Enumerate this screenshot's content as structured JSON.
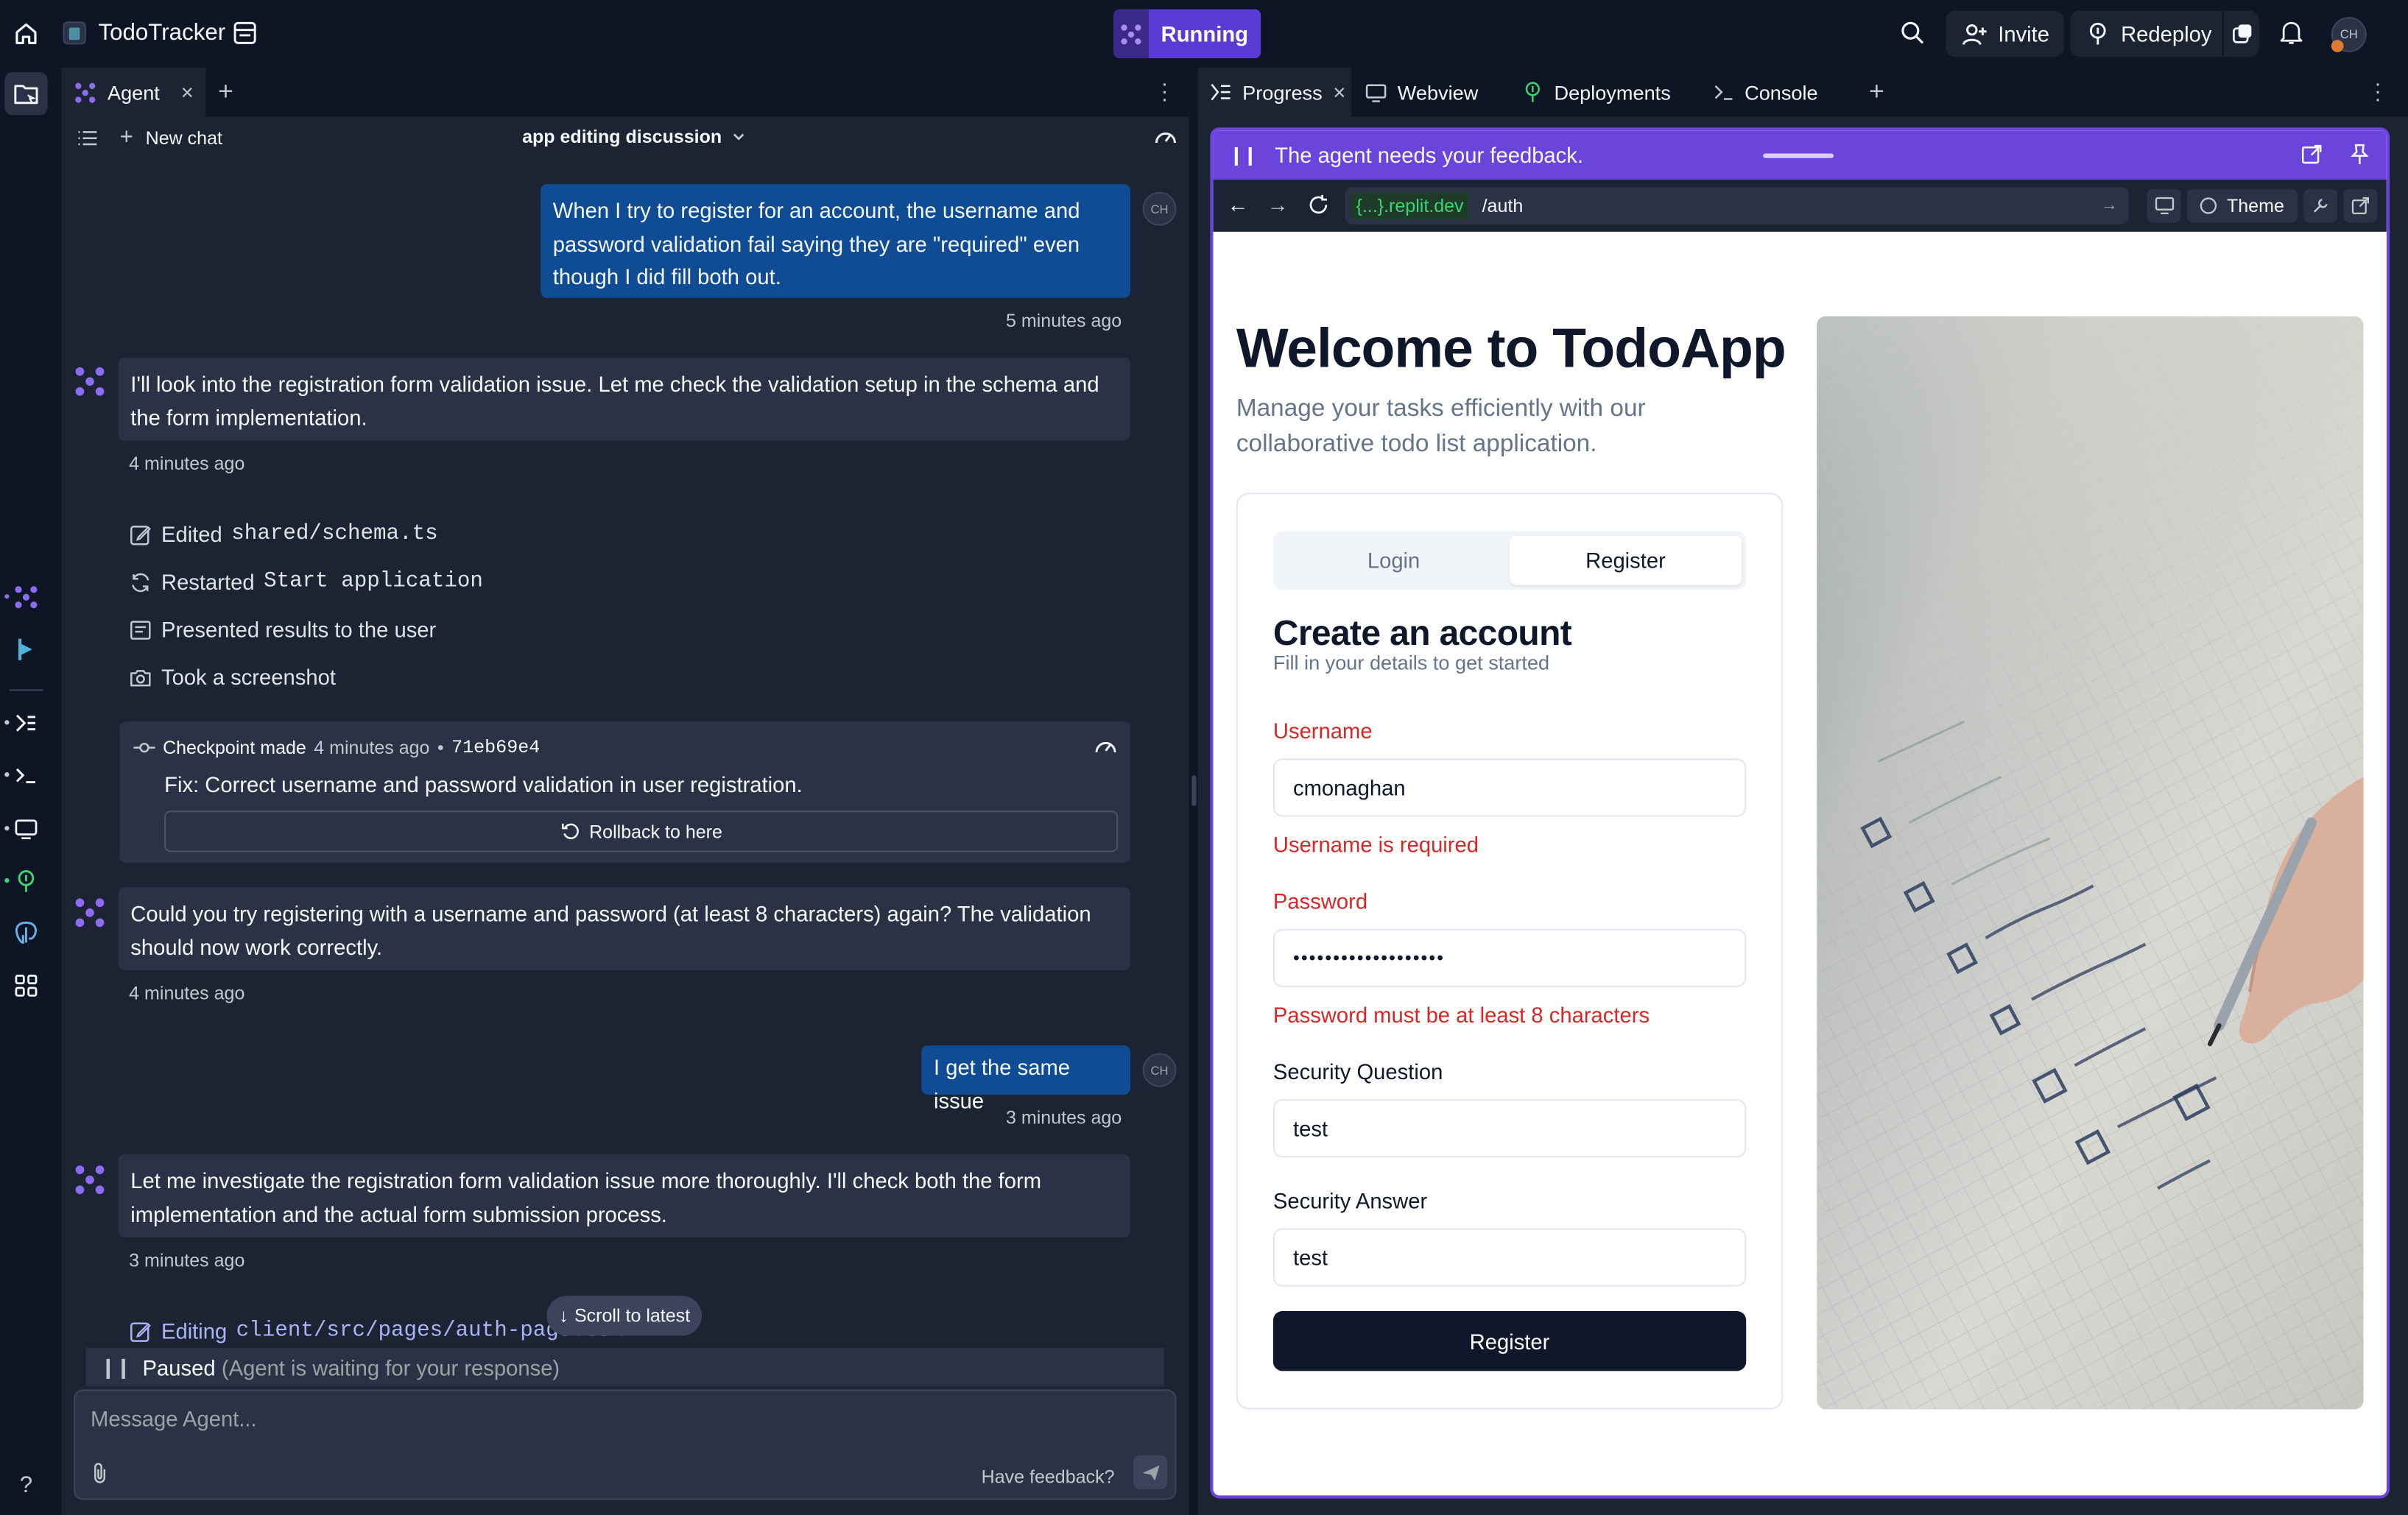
{
  "topbar": {
    "app_name": "TodoTracker",
    "run_label": "Running",
    "invite_label": "Invite",
    "redeploy_label": "Redeploy",
    "avatar_initials": "CH"
  },
  "agent_panel": {
    "tab_label": "Agent",
    "new_chat_label": "New chat",
    "chat_title": "app editing discussion",
    "scroll_latest_label": "Scroll to latest",
    "paused_label": "Paused",
    "paused_detail": "(Agent is waiting for your response)",
    "input_placeholder": "Message Agent...",
    "feedback_label": "Have feedback?",
    "messages": [
      {
        "role": "user",
        "text": "When I try to register for an account, the username and password validation fail saying they are \"required\" even though I did fill both out.",
        "time": "5 minutes ago",
        "initials": "CH"
      },
      {
        "role": "agent",
        "text": "I'll look into the registration form validation issue. Let me check the validation setup in the schema and the form implementation.",
        "time": "4 minutes ago"
      },
      {
        "role": "agent",
        "text": "Could you try registering with a username and password (at least 8 characters) again? The validation should now work correctly.",
        "time": "4 minutes ago"
      },
      {
        "role": "user",
        "text": "I get the same issue",
        "time": "3 minutes ago",
        "initials": "CH"
      },
      {
        "role": "agent",
        "text": "Let me investigate the registration form validation issue more thoroughly. I'll check both the form implementation and the actual form submission process.",
        "time": "3 minutes ago"
      }
    ],
    "actions": [
      {
        "icon": "edit-file-icon",
        "verb": "Edited",
        "target": "shared/schema.ts"
      },
      {
        "icon": "restart-icon",
        "verb": "Restarted",
        "target": "Start application"
      },
      {
        "icon": "present-icon",
        "verb": "Presented results to the user",
        "target": ""
      },
      {
        "icon": "camera-icon",
        "verb": "Took a screenshot",
        "target": ""
      }
    ],
    "checkpoint": {
      "label": "Checkpoint made",
      "time": "4 minutes ago",
      "separator": "•",
      "hash": "71eb69e4",
      "message": "Fix: Correct username and password validation in user registration.",
      "rollback_label": "Rollback to here"
    },
    "editing": {
      "verb": "Editing",
      "target": "client/src/pages/auth-page.tsx"
    }
  },
  "right_panel": {
    "tabs": [
      {
        "label": "Progress",
        "icon": "progress-icon"
      },
      {
        "label": "Webview",
        "icon": "monitor-icon"
      },
      {
        "label": "Deployments",
        "icon": "deploy-icon"
      },
      {
        "label": "Console",
        "icon": "console-icon"
      }
    ],
    "feedback_banner": "The agent needs your feedback.",
    "url_domain": "{...}.replit.dev",
    "url_path": "/auth",
    "theme_label": "Theme"
  },
  "preview": {
    "heading": "Welcome to TodoApp",
    "subheading": "Manage your tasks efficiently with our collaborative todo list application.",
    "tabs": [
      "Login",
      "Register"
    ],
    "active_tab": "Register",
    "form_title": "Create an account",
    "form_subtitle": "Fill in your details to get started",
    "fields": [
      {
        "label": "Username",
        "value": "cmonaghan",
        "error": "Username is required"
      },
      {
        "label": "Password",
        "value": "•••••••••••••••••••",
        "error": "Password must be at least 8 characters"
      },
      {
        "label": "Security Question",
        "value": "test",
        "error": ""
      },
      {
        "label": "Security Answer",
        "value": "test",
        "error": ""
      }
    ],
    "submit_label": "Register"
  },
  "colors": {
    "bg": "#0e1525",
    "panel": "#1c2333",
    "user_bubble": "#0f4c94",
    "agent_bubble": "#2b3245",
    "accent": "#6b45db",
    "error": "#dc2626",
    "success": "#3bd671"
  }
}
